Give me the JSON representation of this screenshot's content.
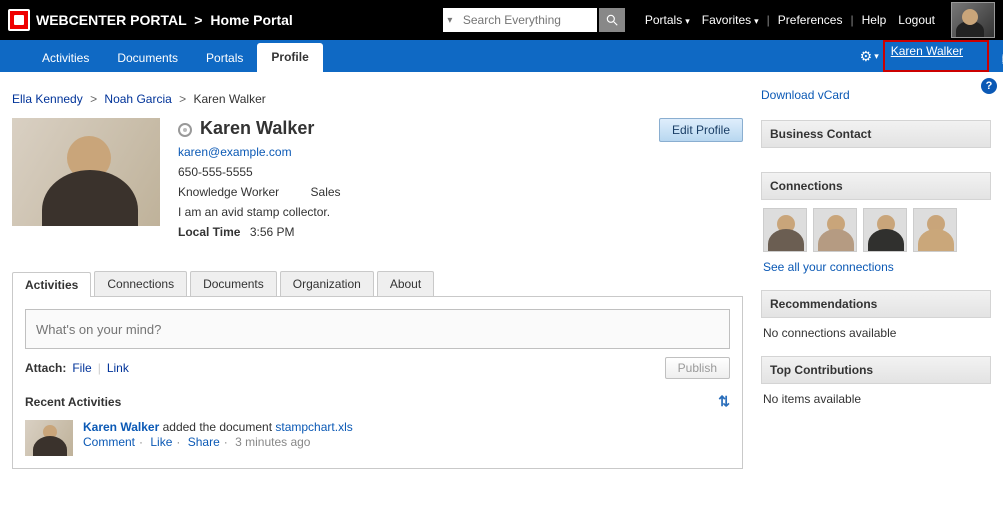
{
  "topbar": {
    "brand_main": "WEBCENTER PORTAL",
    "brand_sep": ">",
    "brand_sub": "Home Portal",
    "search_placeholder": "Search Everything",
    "links": {
      "portals": "Portals",
      "favorites": "Favorites",
      "preferences": "Preferences",
      "help": "Help",
      "logout": "Logout"
    }
  },
  "bluebar": {
    "tabs": [
      "Activities",
      "Documents",
      "Portals",
      "Profile"
    ],
    "active_index": 3,
    "gear_icon": "gear",
    "user_link": "Karen Walker"
  },
  "breadcrumbs": {
    "items": [
      "Ella Kennedy",
      "Noah Garcia"
    ],
    "current": "Karen Walker"
  },
  "profile": {
    "name": "Karen Walker",
    "email": "karen@example.com",
    "phone": "650-555-5555",
    "role": "Knowledge Worker",
    "dept": "Sales",
    "bio": "I am an avid stamp collector.",
    "local_time_label": "Local Time",
    "local_time_value": "3:56 PM",
    "edit_button": "Edit Profile"
  },
  "tabs": {
    "items": [
      "Activities",
      "Connections",
      "Documents",
      "Organization",
      "About"
    ],
    "active_index": 0
  },
  "compose": {
    "placeholder": "What's on your mind?",
    "attach_label": "Attach:",
    "attach_file": "File",
    "attach_link": "Link",
    "publish_label": "Publish"
  },
  "recent": {
    "heading": "Recent Activities",
    "activity": {
      "user": "Karen Walker",
      "action": "added the document",
      "doc": "stampchart.xls",
      "comment": "Comment",
      "like": "Like",
      "share": "Share",
      "time": "3 minutes ago"
    }
  },
  "sidebar": {
    "download_vcard": "Download vCard",
    "business_contact": "Business Contact",
    "connections_head": "Connections",
    "see_all": "See all your connections",
    "recommendations_head": "Recommendations",
    "recommendations_body": "No connections available",
    "top_contrib_head": "Top Contributions",
    "top_contrib_body": "No items available"
  },
  "help_icon": "?"
}
